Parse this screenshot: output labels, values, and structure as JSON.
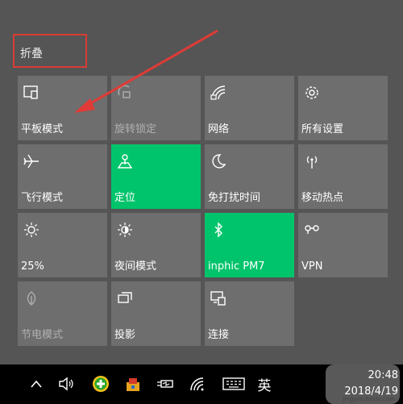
{
  "action_center": {
    "collapse_label": "折叠",
    "tiles": [
      {
        "id": "tablet-mode",
        "label": "平板模式",
        "icon": "tablet-mode-icon",
        "state": "off"
      },
      {
        "id": "rotation-lock",
        "label": "旋转锁定",
        "icon": "rotation-lock-icon",
        "state": "disabled"
      },
      {
        "id": "network",
        "label": "网络",
        "icon": "network-icon",
        "state": "off"
      },
      {
        "id": "all-settings",
        "label": "所有设置",
        "icon": "gear-icon",
        "state": "off"
      },
      {
        "id": "airplane-mode",
        "label": "飞行模式",
        "icon": "airplane-icon",
        "state": "off"
      },
      {
        "id": "location",
        "label": "定位",
        "icon": "location-icon",
        "state": "on"
      },
      {
        "id": "quiet-hours",
        "label": "免打扰时间",
        "icon": "moon-icon",
        "state": "off"
      },
      {
        "id": "mobile-hotspot",
        "label": "移动热点",
        "icon": "hotspot-icon",
        "state": "off"
      },
      {
        "id": "brightness",
        "label": "25%",
        "icon": "brightness-icon",
        "state": "off"
      },
      {
        "id": "night-light",
        "label": "夜间模式",
        "icon": "night-light-icon",
        "state": "off"
      },
      {
        "id": "bluetooth",
        "label": "inphic PM7",
        "icon": "bluetooth-icon",
        "state": "on"
      },
      {
        "id": "vpn",
        "label": "VPN",
        "icon": "vpn-icon",
        "state": "off"
      },
      {
        "id": "battery-saver",
        "label": "节电模式",
        "icon": "battery-saver-icon",
        "state": "disabled"
      },
      {
        "id": "project",
        "label": "投影",
        "icon": "project-icon",
        "state": "off"
      },
      {
        "id": "connect",
        "label": "连接",
        "icon": "connect-icon",
        "state": "off"
      }
    ],
    "colors": {
      "active": "#00c46b",
      "tile": "#6e6e6e",
      "highlight_box": "#d93b34"
    }
  },
  "taskbar": {
    "tray_icons": [
      "chevron-up-icon",
      "volume-icon",
      "green-plus-app-icon",
      "tray-app-icon",
      "power-icon",
      "wifi-icon",
      "keyboard-icon"
    ],
    "ime_label": "英",
    "time": "20:48",
    "date": "2018/4/19"
  }
}
